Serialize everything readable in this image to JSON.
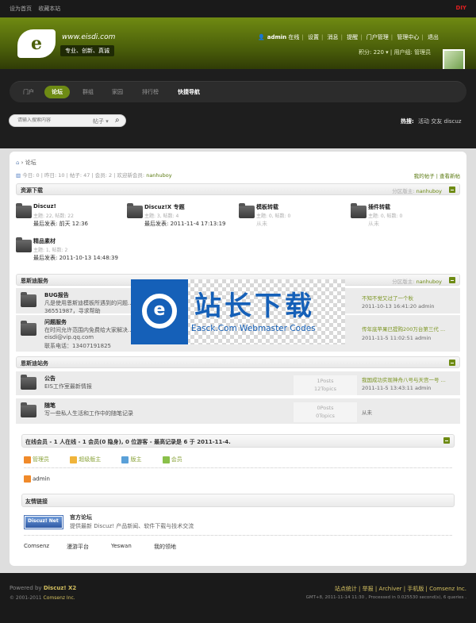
{
  "topbar": {
    "links": [
      "设为首页",
      "收藏本站"
    ],
    "right": "DIY"
  },
  "header": {
    "logo_text": "e",
    "site_url": "www.eisdi.com",
    "slogan": "专业、创新、真诚"
  },
  "user": {
    "name": "admin",
    "status": "在线",
    "links": [
      "设置",
      "消息",
      "提醒",
      "门户管理",
      "管理中心",
      "退出"
    ],
    "credits": "积分: 220",
    "group": "用户组: 管理员"
  },
  "nav": {
    "items": [
      "门户",
      "论坛",
      "群组",
      "家园",
      "排行榜",
      "快捷导航"
    ],
    "active": "论坛"
  },
  "search": {
    "placeholder": "请输入搜索内容",
    "scope": "帖子",
    "hot_label": "热搜:",
    "hot": [
      "活动",
      "交友",
      "discuz"
    ]
  },
  "breadcrumb": "论坛",
  "stats": {
    "today": "今日: 0",
    "yesterday": "昨日: 10",
    "posts": "帖子: 47",
    "members": "会员: 2",
    "welcome": "欢迎新会员:",
    "new_member": "nanhuboy"
  },
  "my_links": [
    "我的帖子",
    "查看新帖"
  ],
  "sections": [
    {
      "title": "资源下载",
      "moderator_label": "分区版主:",
      "moderator": "nanhuboy",
      "forums": [
        {
          "name": "Discuz!",
          "stats": "主题: 22, 帖数: 22",
          "last": "最后发表: 前天 12:36"
        },
        {
          "name": "Discuz!X 专题",
          "stats": "主题: 3, 帖数: 4",
          "last": "最后发表: 2011-11-4 17:13:19"
        },
        {
          "name": "模板转载",
          "stats": "主题: 0, 帖数: 0",
          "last": "从未"
        },
        {
          "name": "插件转载",
          "stats": "主题: 0, 帖数: 0",
          "last": "从未"
        },
        {
          "name": "精品素材",
          "stats": "主题: 1, 帖数: 2",
          "last": "最后发表: 2011-10-13 14:48:39"
        }
      ]
    },
    {
      "title": "恩斯迪服务",
      "moderator_label": "分区版主:",
      "moderator": "nanhuboy",
      "rows": [
        {
          "name": "BUG报告",
          "desc": [
            "凡是使用恩斯迪模板所遇到的问题...",
            "36551987，寻求帮助"
          ],
          "last_title": "不知不觉又过了一个秋",
          "last_meta": "2011-10-13 16:41:20 admin"
        },
        {
          "name": "问题服务",
          "desc": [
            "在时间允许范围内免费给大家解决...",
            "eisdi@vip.qq.com",
            "联系电话：13407191825"
          ],
          "last_title": "传年底苹果已提购200万台第三代 ...",
          "last_meta": "2011-11-5 11:02:51 admin"
        }
      ]
    },
    {
      "title": "恩斯迪站务",
      "rows": [
        {
          "name": "公告",
          "desc": [
            "EIS工作室最新情报"
          ],
          "count1": "1Posts",
          "count2": "12Topics",
          "last_title": "我国成功实现神舟八号与天宫一号 ...",
          "last_meta": "2011-11-5 13:43:11 admin"
        },
        {
          "name": "随笔",
          "desc": [
            "写一些私人生活和工作中的随笔记录"
          ],
          "count1": "0Posts",
          "count2": "0Topics",
          "last_title": "",
          "last_meta": "从未"
        }
      ]
    }
  ],
  "online": {
    "title": "在线会员 - 1 人在线 - 1 会员(0 隐身), 0 位游客 - 最高记录是 6 于 2011-11-4.",
    "legend": [
      "管理员",
      "超级版主",
      "版主",
      "会员"
    ],
    "legend_colors": [
      "#f08a2a",
      "#f0b43a",
      "#5aa0d8",
      "#8ac04a"
    ],
    "users": [
      "admin"
    ]
  },
  "friend_links": {
    "title": "友情链接",
    "main_name": "官方论坛",
    "main_desc": "提供最新 Discuz! 产品新闻、软件下载与技术交流",
    "badge": "Discuz! Net",
    "links": [
      "Comsenz",
      "漫游平台",
      "Yeswan",
      "我的领地"
    ]
  },
  "watermark": {
    "cn": "站长下载",
    "en": "Easck.Com Webmaster Codes",
    "glyph": "e"
  },
  "footer": {
    "powered_by": "Powered by",
    "product": "Discuz! X2",
    "copyright": "© 2001-2011",
    "company": "Comsenz Inc.",
    "links": "站点统计 | 举报 | Archiver | 手机版 | Comsenz Inc.",
    "runtime": "GMT+8, 2011-11-14 11:30 , Processed in 0.025530 second(s), 6 queries ."
  }
}
